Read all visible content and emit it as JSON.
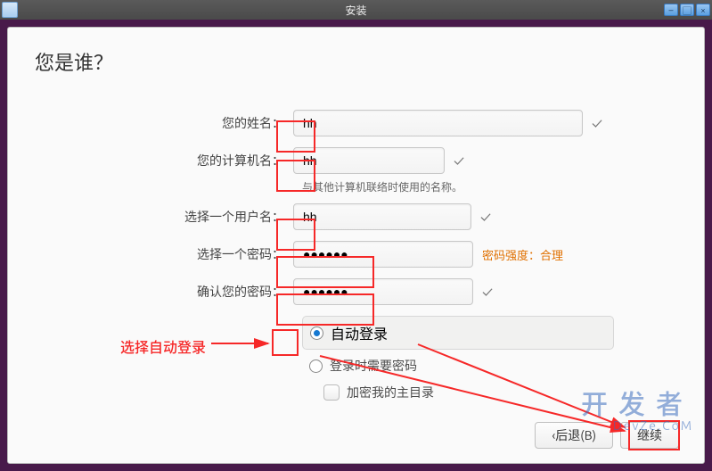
{
  "window": {
    "title": "安装",
    "min_icon": "–",
    "max_icon": "▢",
    "close_icon": "×"
  },
  "page": {
    "title": "您是谁？"
  },
  "form": {
    "name_label": "您的姓名：",
    "name_value": "hh",
    "host_label": "您的计算机名：",
    "host_value": "hh",
    "host_hint": "与其他计算机联络时使用的名称。",
    "user_label": "选择一个用户名：",
    "user_value": "hh",
    "pass_label": "选择一个密码：",
    "pass_value": "●●●●●●",
    "pass_strength": "密码强度：合理",
    "confirm_label": "确认您的密码：",
    "confirm_value": "●●●●●●"
  },
  "login": {
    "auto_label": "自动登录",
    "auto_selected": true,
    "require_label": "登录时需要密码",
    "encrypt_label": "加密我的主目录"
  },
  "nav": {
    "back": "后退(B)",
    "continue": "继续"
  },
  "annotation": {
    "choose_auto": "选择自动登录"
  },
  "watermark": {
    "big": "开发者",
    "small": "DevZe.CoM"
  }
}
